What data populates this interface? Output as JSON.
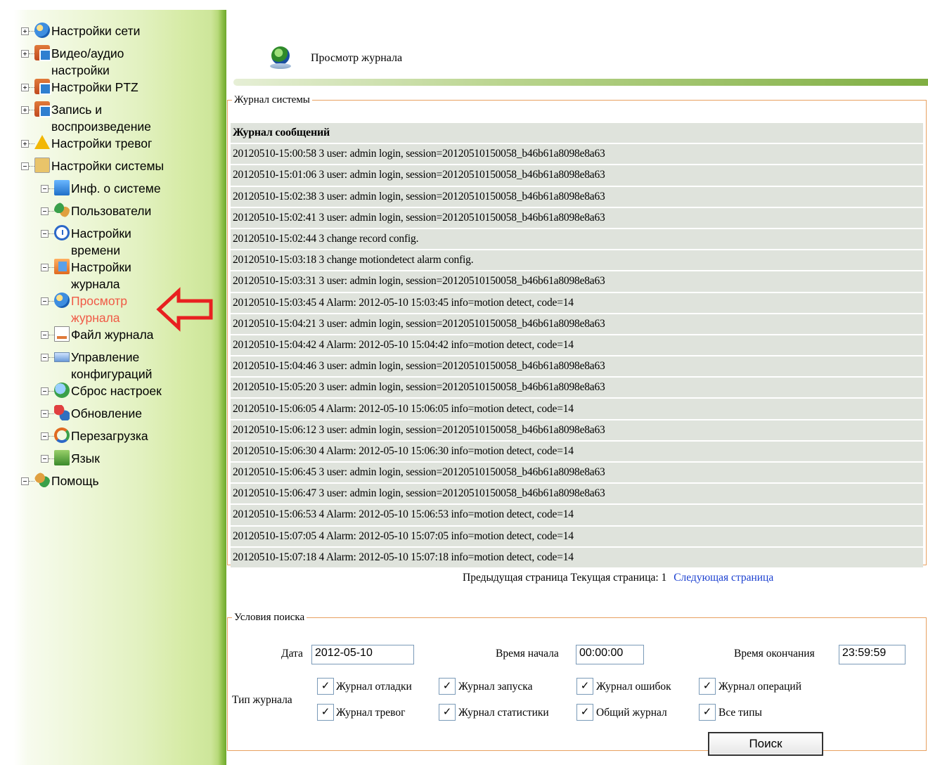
{
  "sidebar": {
    "items": [
      {
        "label": "Настройки сети",
        "icon": "network-globe-icon"
      },
      {
        "label": "Видео/аудио настройки",
        "icon": "camera-icon"
      },
      {
        "label": "Настройки PTZ",
        "icon": "camera-icon"
      },
      {
        "label": "Запись и воспроизведение",
        "icon": "camera-icon"
      },
      {
        "label": "Настройки тревог",
        "icon": "warning-icon"
      },
      {
        "label": "Настройки системы",
        "icon": "system-settings-icon"
      },
      {
        "label": "Инф. о системе",
        "icon": "info-icon"
      },
      {
        "label": "Пользователи",
        "icon": "users-icon"
      },
      {
        "label": "Настройки времени",
        "icon": "clock-icon"
      },
      {
        "label": "Настройки журнала",
        "icon": "journal-settings-icon"
      },
      {
        "label": "Просмотр журнала",
        "icon": "log-view-globe-icon"
      },
      {
        "label": "Файл журнала",
        "icon": "file-icon"
      },
      {
        "label": "Управление конфигураций",
        "icon": "config-icon"
      },
      {
        "label": "Сброс настроек",
        "icon": "reset-icon"
      },
      {
        "label": "Обновление",
        "icon": "update-icon"
      },
      {
        "label": "Перезагрузка",
        "icon": "reboot-icon"
      },
      {
        "label": "Язык",
        "icon": "language-icon"
      },
      {
        "label": "Помощь",
        "icon": "help-icon"
      }
    ]
  },
  "header": {
    "title": "Просмотр журнала"
  },
  "log": {
    "legend": "Журнал системы",
    "heading": "Журнал сообщений",
    "entries": [
      "20120510-15:00:58 3 user: admin login, session=20120510150058_b46b61a8098e8a63",
      "20120510-15:01:06 3 user: admin login, session=20120510150058_b46b61a8098e8a63",
      "20120510-15:02:38 3 user: admin login, session=20120510150058_b46b61a8098e8a63",
      "20120510-15:02:41 3 user: admin login, session=20120510150058_b46b61a8098e8a63",
      "20120510-15:02:44 3 change record config.",
      "20120510-15:03:18 3 change motiondetect alarm config.",
      "20120510-15:03:31 3 user: admin login, session=20120510150058_b46b61a8098e8a63",
      "20120510-15:03:45 4 Alarm: 2012-05-10 15:03:45 info=motion detect, code=14",
      "20120510-15:04:21 3 user: admin login, session=20120510150058_b46b61a8098e8a63",
      "20120510-15:04:42 4 Alarm: 2012-05-10 15:04:42 info=motion detect, code=14",
      "20120510-15:04:46 3 user: admin login, session=20120510150058_b46b61a8098e8a63",
      "20120510-15:05:20 3 user: admin login, session=20120510150058_b46b61a8098e8a63",
      "20120510-15:06:05 4 Alarm: 2012-05-10 15:06:05 info=motion detect, code=14",
      "20120510-15:06:12 3 user: admin login, session=20120510150058_b46b61a8098e8a63",
      "20120510-15:06:30 4 Alarm: 2012-05-10 15:06:30 info=motion detect, code=14",
      "20120510-15:06:45 3 user: admin login, session=20120510150058_b46b61a8098e8a63",
      "20120510-15:06:47 3 user: admin login, session=20120510150058_b46b61a8098e8a63",
      "20120510-15:06:53 4 Alarm: 2012-05-10 15:06:53 info=motion detect, code=14",
      "20120510-15:07:05 4 Alarm: 2012-05-10 15:07:05 info=motion detect, code=14",
      "20120510-15:07:18 4 Alarm: 2012-05-10 15:07:18 info=motion detect, code=14"
    ]
  },
  "pager": {
    "prev": "Предыдущая страница",
    "current": "Текущая страница: 1",
    "next": "Следующая страница"
  },
  "search": {
    "legend": "Условия поиска",
    "date_label": "Дата",
    "date_value": "2012-05-10",
    "start_label": "Время начала",
    "start_value": "00:00:00",
    "end_label": "Время окончания",
    "end_value": "23:59:59",
    "type_label": "Тип журнала",
    "types": [
      {
        "label": "Журнал отладки",
        "checked": true
      },
      {
        "label": "Журнал запуска",
        "checked": true
      },
      {
        "label": "Журнал ошибок",
        "checked": true
      },
      {
        "label": "Журнал операций",
        "checked": true
      },
      {
        "label": "Журнал тревог",
        "checked": true
      },
      {
        "label": "Журнал статистики",
        "checked": true
      },
      {
        "label": "Общий журнал",
        "checked": true
      },
      {
        "label": "Все типы",
        "checked": true
      }
    ],
    "button_label": "Поиск"
  },
  "colors": {
    "selected_item": "#f05a46",
    "link": "#1a3fd0",
    "row_bg": "#dfe3dc",
    "fieldset_border": "#e8a060",
    "annotation_arrow": "#e82020"
  }
}
